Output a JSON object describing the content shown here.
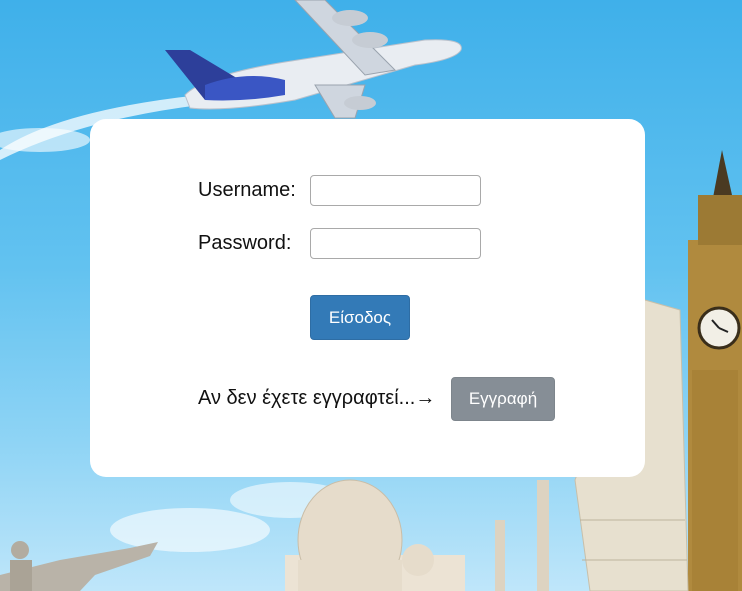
{
  "login": {
    "username_label": "Username:",
    "password_label": "Password:",
    "username_value": "",
    "password_value": "",
    "login_button": "Είσοδος"
  },
  "register": {
    "prompt": "Αν δεν έχετε εγγραφτεί...→",
    "button": "Εγγραφή"
  },
  "colors": {
    "primary_button": "#337ab7",
    "secondary_button": "#868e96",
    "card_background": "#ffffff"
  }
}
